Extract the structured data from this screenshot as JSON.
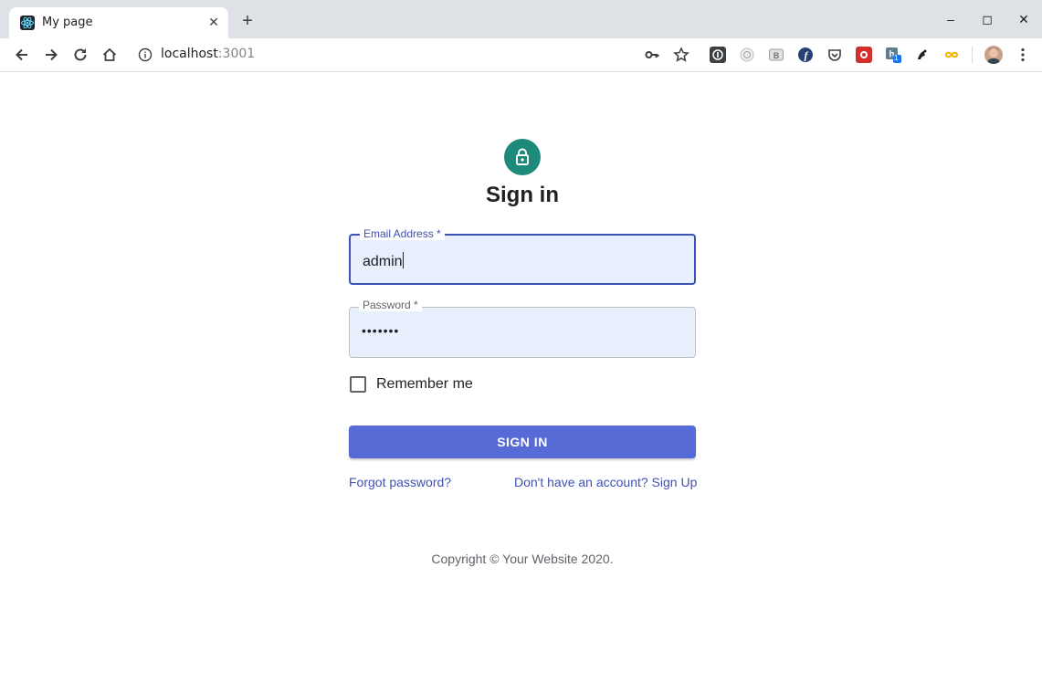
{
  "browser": {
    "tab": {
      "title": "My page",
      "favicon": "react-icon",
      "close": "✕"
    },
    "new_tab": "+",
    "window_controls": {
      "minimize": "–",
      "maximize": "◻",
      "close": "✕"
    },
    "address": {
      "host": "localhost",
      "port": ":3001"
    },
    "extensions": [
      "1password-icon",
      "circle-extension-icon",
      "b-extension-icon",
      "fedora-icon",
      "pocket-icon",
      "red-extension-icon",
      "h-extension-icon",
      "bird-extension-icon",
      "infinity-extension-icon"
    ],
    "badge": "1"
  },
  "page": {
    "title": "Sign in",
    "email": {
      "label": "Email Address *",
      "value": "admin"
    },
    "password": {
      "label": "Password *",
      "value": "•••••••"
    },
    "remember_label": "Remember me",
    "submit_label": "SIGN IN",
    "forgot_link": "Forgot password?",
    "signup_link": "Don't have an account? Sign Up",
    "copyright": "Copyright © Your Website 2020."
  },
  "colors": {
    "primary": "#3f51b5",
    "button": "#566bd6",
    "lock_avatar": "#1e8a7a",
    "autofill": "#e8f0fe"
  }
}
